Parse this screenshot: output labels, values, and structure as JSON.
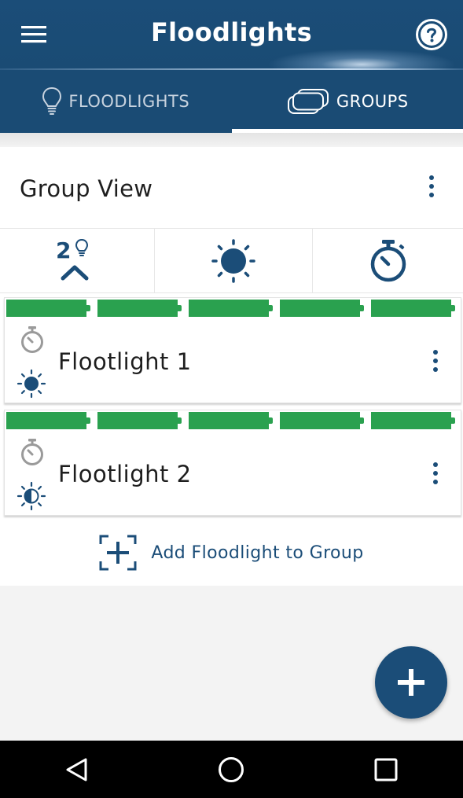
{
  "app": {
    "title": "Floodlights"
  },
  "tabs": [
    {
      "label": "FLOODLIGHTS",
      "icon": "lightbulb-icon",
      "active": false
    },
    {
      "label": "GROUPS",
      "icon": "groups-icon",
      "active": true
    }
  ],
  "group": {
    "title": "Group View",
    "controls": {
      "sort_count": "2",
      "sort_icon": "lightbulb-sort-up-icon",
      "brightness_icon": "sun-icon",
      "timer_icon": "stopwatch-icon"
    }
  },
  "floodlights": [
    {
      "name": "Flootlight 1",
      "battery_segments": 5,
      "status_icons": [
        "stopwatch-icon",
        "sun-icon"
      ]
    },
    {
      "name": "Flootlight 2",
      "battery_segments": 5,
      "status_icons": [
        "stopwatch-icon",
        "half-sun-icon"
      ]
    }
  ],
  "add_action": {
    "label": "Add Floodlight to Group",
    "icon": "add-to-group-icon"
  },
  "fab": {
    "icon": "plus-icon"
  },
  "system_nav": [
    "back-icon",
    "home-icon",
    "recents-icon"
  ],
  "colors": {
    "primary": "#1b4d78",
    "battery": "#2aa14f",
    "background": "#f3f3f3"
  }
}
